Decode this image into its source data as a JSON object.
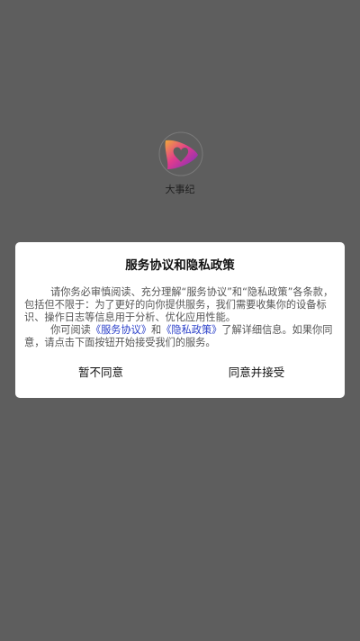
{
  "splash": {
    "app_name": "大事纪",
    "logo_icon": "play-heart-logo-icon"
  },
  "dialog": {
    "title": "服务协议和隐私政策",
    "paragraph1": "请你务必审慎阅读、充分理解“服务协议”和“隐私政策”各条款，包括但不限于：为了更好的向你提供服务，我们需要收集你的设备标识、操作日志等信息用于分析、优化应用性能。",
    "paragraph2_prefix": "你可阅读",
    "service_link": "《服务协议》",
    "conjunction": "和",
    "privacy_link": "《隐私政策》",
    "paragraph2_suffix": "了解详细信息。如果你同意，请点击下面按钮开始接受我们的服务。",
    "decline_label": "暂不同意",
    "accept_label": "同意并接受"
  },
  "colors": {
    "overlay": "#5e5e5e",
    "link": "#2a3fc9",
    "logo_gradient_start": "#e23b8c",
    "logo_gradient_end": "#7a2fc0"
  }
}
